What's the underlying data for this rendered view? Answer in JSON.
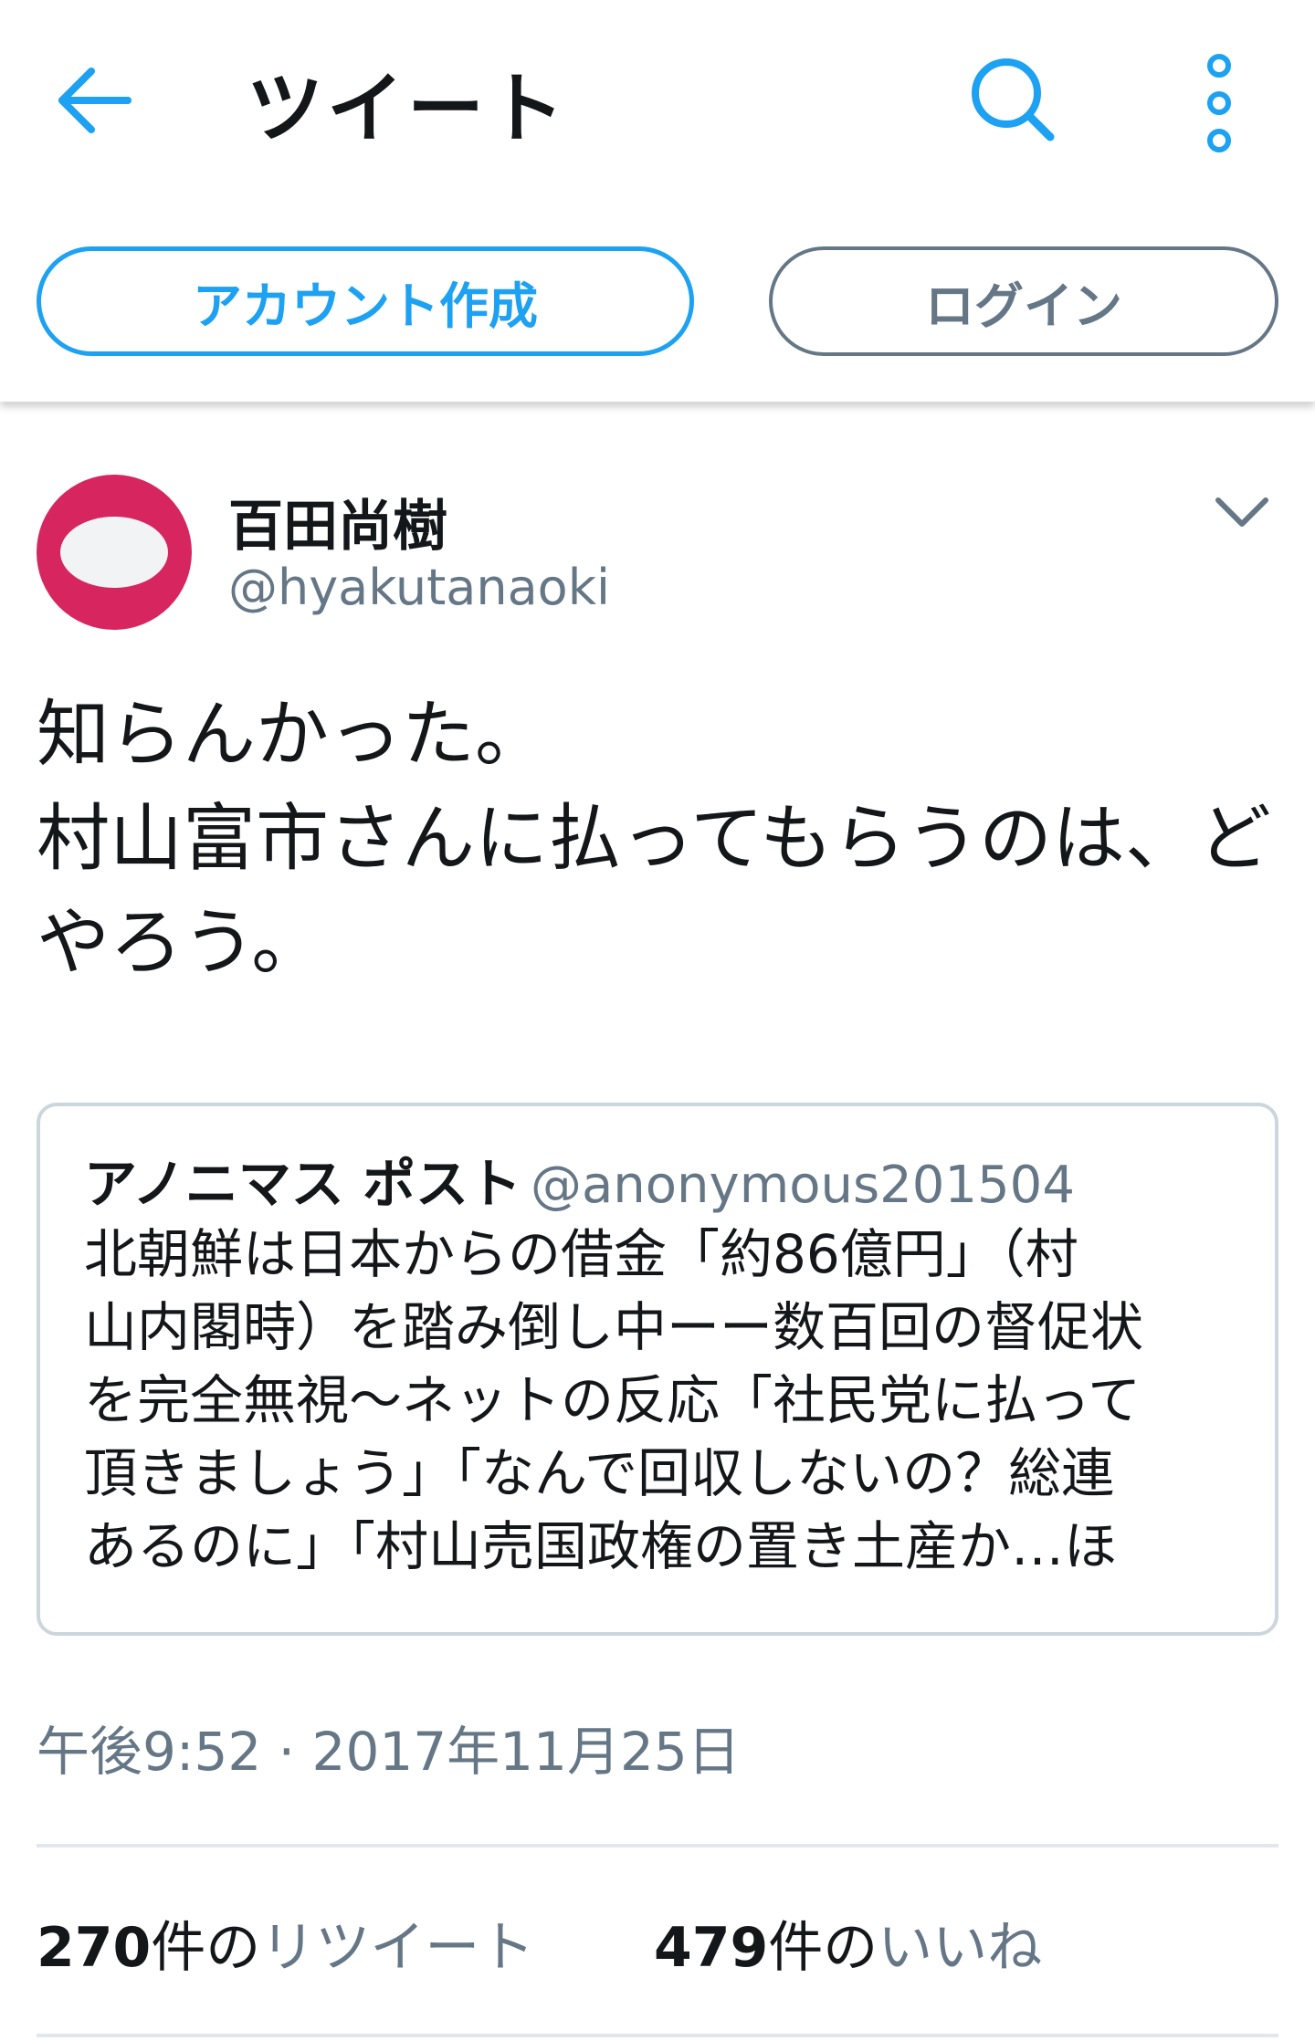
{
  "header": {
    "title": "ツイート",
    "signup_label": "アカウント作成",
    "login_label": "ログイン",
    "accent_color": "#1da1f2"
  },
  "icons": {
    "back": "arrow-left-icon",
    "search": "search-icon",
    "more": "more-vertical-icon",
    "caret": "chevron-down-icon"
  },
  "tweet": {
    "author_name": "百田尚樹",
    "author_handle": "@hyakutanaoki",
    "text_lines": [
      "知らんかった。",
      "村山富市さんに払ってもらうのは、ど",
      "やろう。"
    ],
    "timestamp": "午後9:52 · 2017年11月25日"
  },
  "quote": {
    "name": "アノニマス ポスト",
    "handle": "@anonymous201504",
    "text_lines": [
      "北朝鮮は日本からの借金「約86億円」（村",
      "山内閣時）を踏み倒し中ーー数百回の督促状",
      "を完全無視〜ネットの反応「社民党に払って",
      "頂きましょう」「なんで回収しないの？総連",
      "あるのに」「村山売国政権の置き土産か…ほ"
    ]
  },
  "stats": {
    "retweets": {
      "count": "270",
      "unit": "件の",
      "label": "リツイート"
    },
    "likes": {
      "count": "479",
      "unit": "件の",
      "label": "いいね"
    }
  }
}
